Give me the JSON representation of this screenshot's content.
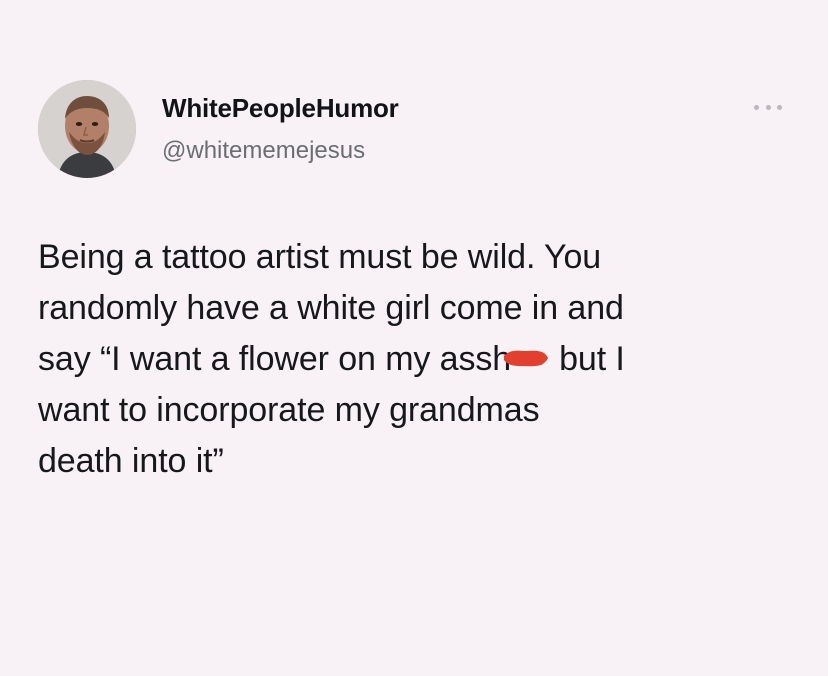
{
  "tweet": {
    "display_name": "WhitePeopleHumor",
    "handle": "@whitememejesus",
    "more_icon": "more-horizontal-icon",
    "avatar_icon": "avatar-photo",
    "text_lines": [
      "Being a tattoo artist must be wild. You",
      "randomly have a white girl come in and",
      "say “I want a flower on my assh",
      "but I",
      "want to incorporate my grandmas",
      "death into it”"
    ],
    "redaction_color": "#e1402f"
  }
}
